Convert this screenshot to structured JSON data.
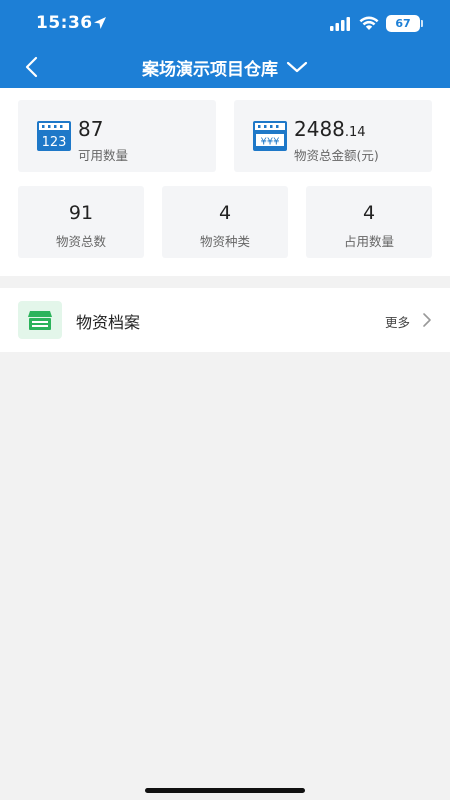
{
  "status_bar": {
    "time": "15:36",
    "battery_level": "67",
    "icons": [
      "location-arrow-icon",
      "signal-icon",
      "wifi-icon",
      "battery-icon"
    ]
  },
  "nav": {
    "title": "案场演示项目仓库",
    "back_icon": "chevron-left-icon",
    "dropdown_icon": "chevron-down-icon"
  },
  "stats": {
    "available": {
      "value": "87",
      "label": "可用数量",
      "icon": "number-board-icon"
    },
    "total_amount": {
      "value_main": "2488",
      "value_decimal": ".14",
      "label": "物资总金额(元)",
      "icon": "yuan-board-icon"
    },
    "small": [
      {
        "value": "91",
        "label": "物资总数"
      },
      {
        "value": "4",
        "label": "物资种类"
      },
      {
        "value": "4",
        "label": "占用数量"
      }
    ]
  },
  "archive": {
    "label": "物资档案",
    "more": "更多",
    "icon": "storefront-icon"
  },
  "colors": {
    "header_bg": "#1d7fd6",
    "icon_blue": "#1e78c8",
    "icon_green": "#2bb35b",
    "page_bg": "#f2f2f2"
  }
}
